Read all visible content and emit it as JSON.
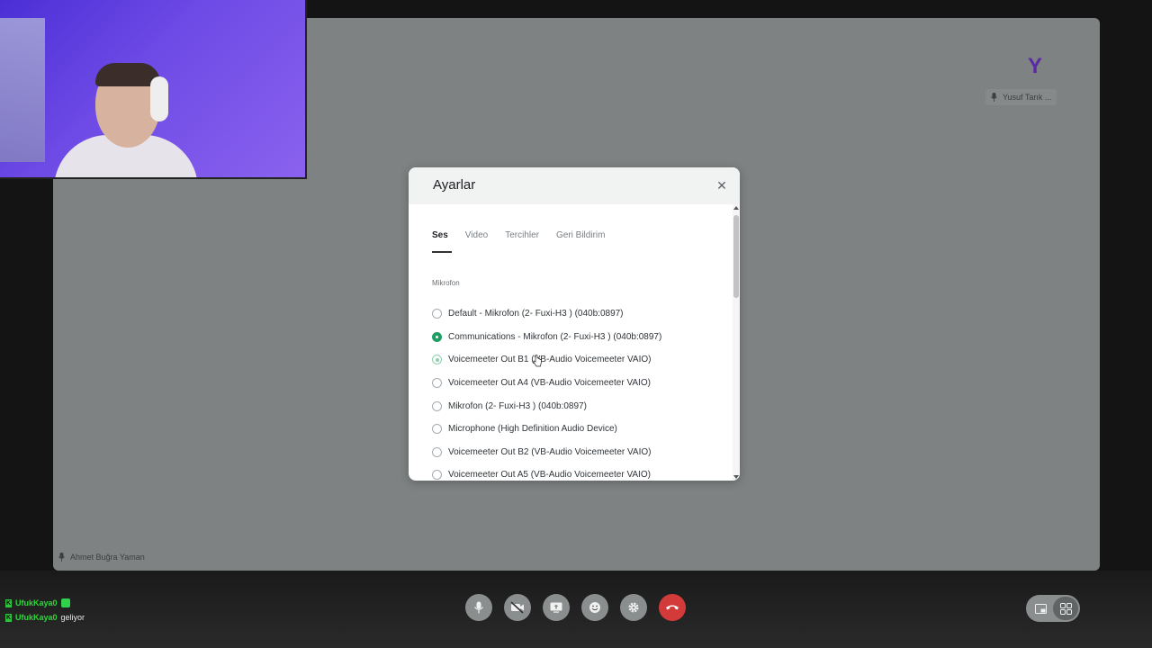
{
  "webcam": {
    "description_icon": "person-avatar-icon"
  },
  "stage": {
    "local_participant": "Ahmet Buğra Yaman",
    "remote_participant": {
      "initial": "Y",
      "name": "Yusuf Tarık ..."
    }
  },
  "settings_dialog": {
    "title": "Ayarlar",
    "close_icon": "close-icon",
    "tabs": [
      {
        "label": "Ses",
        "active": true
      },
      {
        "label": "Video",
        "active": false
      },
      {
        "label": "Tercihler",
        "active": false
      },
      {
        "label": "Geri Bildirim",
        "active": false
      }
    ],
    "section_label": "Mikrofon",
    "options": [
      {
        "label": "Default - Mikrofon (2- Fuxi-H3 ) (040b:0897)",
        "state": "unselected"
      },
      {
        "label": "Communications - Mikrofon (2- Fuxi-H3 ) (040b:0897)",
        "state": "selected"
      },
      {
        "label": "Voicemeeter Out B1 (VB-Audio Voicemeeter VAIO)",
        "state": "hover"
      },
      {
        "label": "Voicemeeter Out A4 (VB-Audio Voicemeeter VAIO)",
        "state": "unselected"
      },
      {
        "label": "Mikrofon (2- Fuxi-H3 ) (040b:0897)",
        "state": "unselected"
      },
      {
        "label": "Microphone (High Definition Audio Device)",
        "state": "unselected"
      },
      {
        "label": "Voicemeeter Out B2 (VB-Audio Voicemeeter VAIO)",
        "state": "unselected"
      },
      {
        "label": "Voicemeeter Out A5 (VB-Audio Voicemeeter VAIO)",
        "state": "unselected"
      }
    ],
    "accent_color": "#1e9e63"
  },
  "chat": [
    {
      "badge": "K",
      "user": "UfukKaya0",
      "message": "",
      "emote": true
    },
    {
      "badge": "K",
      "user": "UfukKaya0",
      "message": "geliyor",
      "emote": false
    }
  ],
  "toolbar": {
    "buttons": [
      {
        "icon": "microphone-icon"
      },
      {
        "icon": "camera-off-icon"
      },
      {
        "icon": "screen-share-icon"
      },
      {
        "icon": "emoji-icon"
      },
      {
        "icon": "settings-gear-icon"
      },
      {
        "icon": "hang-up-icon",
        "color": "#d33a3a"
      }
    ],
    "layout_buttons": [
      {
        "icon": "pip-layout-icon",
        "active": false
      },
      {
        "icon": "grid-layout-icon",
        "active": true
      }
    ]
  }
}
